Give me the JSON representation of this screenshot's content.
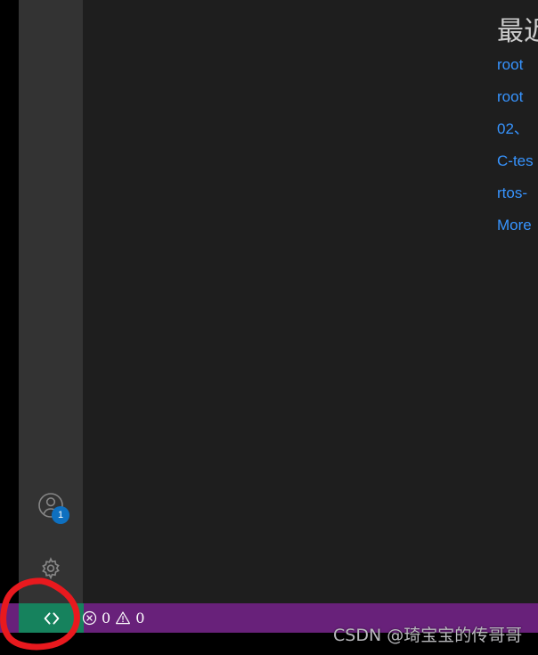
{
  "colors": {
    "activitybar_bg": "#333333",
    "editor_bg": "#1e1e1e",
    "statusbar_bg": "#68217a",
    "remote_bg": "#16825d",
    "link": "#3794ff",
    "badge": "#0e70c0",
    "annotation_red": "#e8191e",
    "title_fg": "#cccccc"
  },
  "activitybar": {
    "items": [
      {
        "name": "accounts",
        "icon": "account-icon",
        "badge": "1"
      },
      {
        "name": "manage",
        "icon": "gear-icon",
        "badge": ""
      }
    ]
  },
  "welcome": {
    "recent_title": "最近",
    "recent_items": [
      {
        "label": "root"
      },
      {
        "label": "root"
      },
      {
        "label": "02、"
      },
      {
        "label": "C-tes"
      },
      {
        "label": "rtos-"
      },
      {
        "label": "More"
      }
    ]
  },
  "statusbar": {
    "remote_label": "><",
    "remote_icon": "remote-host-icon",
    "error_icon": "error-circle-icon",
    "error_count": "0",
    "warning_icon": "warning-triangle-icon",
    "warning_count": "0"
  },
  "annotation": {
    "shape": "hand-drawn-ellipse",
    "target": "remote-indicator"
  },
  "watermark": {
    "text": "CSDN @琦宝宝的传哥哥"
  }
}
